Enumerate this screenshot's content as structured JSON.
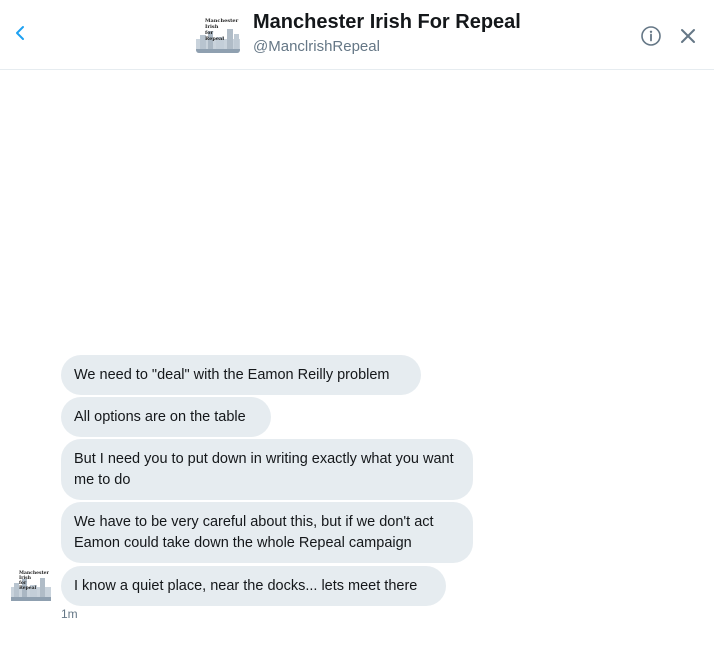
{
  "conversation": {
    "name": "Manchester Irish For Repeal",
    "handle": "@ManclrishRepeal",
    "avatar_text": [
      "Manchester",
      "Irish",
      "for",
      "Repeal"
    ]
  },
  "icons": {
    "back": "chevron-left-icon",
    "info": "info-circle-icon",
    "close": "close-icon"
  },
  "messages": [
    {
      "text": "We need to \"deal\" with the Eamon Reilly problem"
    },
    {
      "text": "All options are on the table"
    },
    {
      "text": "But I need you to put down in writing exactly what you want me to do"
    },
    {
      "text": "We have to be very careful about this, but if we don't act Eamon could take down the whole Repeal campaign"
    },
    {
      "text": "I know a quiet place, near the docks... lets meet there"
    }
  ],
  "last_timestamp": "1m",
  "colors": {
    "accent": "#1da1f2",
    "bubble": "#e6ecf0",
    "muted": "#657786",
    "text": "#14171a"
  }
}
